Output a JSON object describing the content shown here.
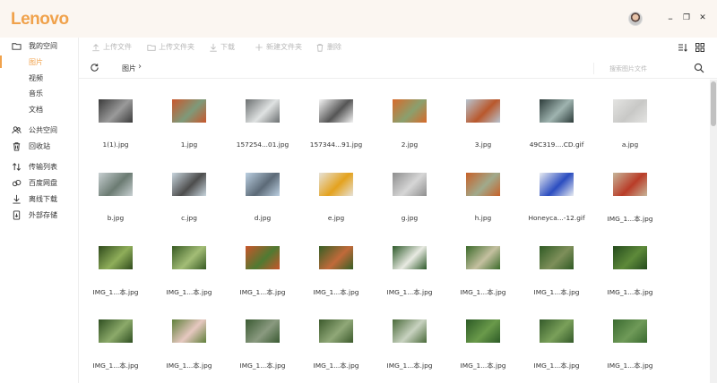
{
  "app": {
    "logo_text": "Lenovo"
  },
  "window": {
    "minimize_glyph": "–",
    "restore_glyph": "❐",
    "close_glyph": "✕"
  },
  "colors": {
    "accent": "#f0a24c",
    "titlebar_bg": "#fbf6f1",
    "icon_gray": "#b8b8b8"
  },
  "sidebar": {
    "items": [
      {
        "label": "我的空间",
        "icon": "folder-icon",
        "active": false
      },
      {
        "label": "图片",
        "icon": "",
        "active": true
      },
      {
        "label": "视频",
        "icon": "",
        "active": false
      },
      {
        "label": "音乐",
        "icon": "",
        "active": false
      },
      {
        "label": "文档",
        "icon": "",
        "active": false
      },
      {
        "label": "公共空间",
        "icon": "users-icon",
        "active": false
      },
      {
        "label": "回收站",
        "icon": "trash-icon",
        "active": false
      },
      {
        "label": "传输列表",
        "icon": "transfer-icon",
        "active": false
      },
      {
        "label": "百度网盘",
        "icon": "cloud-icon",
        "active": false
      },
      {
        "label": "离线下载",
        "icon": "download-icon",
        "active": false
      },
      {
        "label": "外部存储",
        "icon": "usb-drive-icon",
        "active": false
      }
    ]
  },
  "toolbar": {
    "upload_file": "上传文件",
    "upload_folder": "上传文件夹",
    "download": "下载",
    "new_folder": "新建文件夹",
    "delete": "删除"
  },
  "path": {
    "crumb": "图片"
  },
  "search": {
    "placeholder": "搜索图片文件"
  },
  "files": [
    {
      "name": "1(1).jpg",
      "c1": "#3b3b3b",
      "c2": "#9a9a9a"
    },
    {
      "name": "1.jpg",
      "c1": "#c9572c",
      "c2": "#7e9a7a"
    },
    {
      "name": "157254...01.jpg",
      "c1": "#6b6f70",
      "c2": "#dfe2e2"
    },
    {
      "name": "157344...91.jpg",
      "c1": "#f4f4f4",
      "c2": "#555555"
    },
    {
      "name": "2.jpg",
      "c1": "#d86a2a",
      "c2": "#8aa06e"
    },
    {
      "name": "3.jpg",
      "c1": "#b8c4d0",
      "c2": "#b9582c"
    },
    {
      "name": "49C319....CD.gif",
      "c1": "#2d3c3a",
      "c2": "#9fb4b0"
    },
    {
      "name": "a.jpg",
      "c1": "#e4e4e2",
      "c2": "#c8c8c6"
    },
    {
      "name": "b.jpg",
      "c1": "#c8d0d2",
      "c2": "#6b7b72"
    },
    {
      "name": "c.jpg",
      "c1": "#c9d6de",
      "c2": "#4d4d4d"
    },
    {
      "name": "d.jpg",
      "c1": "#bcd0e2",
      "c2": "#5c6a77"
    },
    {
      "name": "e.jpg",
      "c1": "#e6e2d8",
      "c2": "#e4a21e"
    },
    {
      "name": "g.jpg",
      "c1": "#8e8e8e",
      "c2": "#d6d6d6"
    },
    {
      "name": "h.jpg",
      "c1": "#c76128",
      "c2": "#a0aa8c"
    },
    {
      "name": "Honeyca...-12.gif",
      "c1": "#e8ecf2",
      "c2": "#2b4dc0"
    },
    {
      "name": "IMG_1...本.jpg",
      "c1": "#c7b69a",
      "c2": "#b93c28"
    },
    {
      "name": "IMG_1...本.jpg",
      "c1": "#2f4a1c",
      "c2": "#8fae5a"
    },
    {
      "name": "IMG_1...本.jpg",
      "c1": "#375a23",
      "c2": "#a3bd76"
    },
    {
      "name": "IMG_1...本.jpg",
      "c1": "#c9552a",
      "c2": "#4f7a32"
    },
    {
      "name": "IMG_1...本.jpg",
      "c1": "#365f25",
      "c2": "#c16a3a"
    },
    {
      "name": "IMG_1...本.jpg",
      "c1": "#2e5a2a",
      "c2": "#e8eae2"
    },
    {
      "name": "IMG_1...本.jpg",
      "c1": "#3b6a2a",
      "c2": "#c4c0a0"
    },
    {
      "name": "IMG_1...本.jpg",
      "c1": "#2f5a24",
      "c2": "#7e8f5a"
    },
    {
      "name": "IMG_1...本.jpg",
      "c1": "#244a1c",
      "c2": "#5e8a3a"
    },
    {
      "name": "IMG_1...本.jpg",
      "c1": "#2f4f22",
      "c2": "#8caa6a"
    },
    {
      "name": "IMG_1...本.jpg",
      "c1": "#5f7f3a",
      "c2": "#e6c8c0"
    },
    {
      "name": "IMG_1...本.jpg",
      "c1": "#3a5a32",
      "c2": "#8a9a80"
    },
    {
      "name": "IMG_1...本.jpg",
      "c1": "#3c5a2c",
      "c2": "#90a878"
    },
    {
      "name": "IMG_1...本.jpg",
      "c1": "#4a6a3a",
      "c2": "#c8d2c0"
    },
    {
      "name": "IMG_1...本.jpg",
      "c1": "#2c5a26",
      "c2": "#6a9a4a"
    },
    {
      "name": "IMG_1...本.jpg",
      "c1": "#345a2a",
      "c2": "#7aa05a"
    },
    {
      "name": "IMG_1...本.jpg",
      "c1": "#3a6a30",
      "c2": "#6f9a58"
    }
  ]
}
